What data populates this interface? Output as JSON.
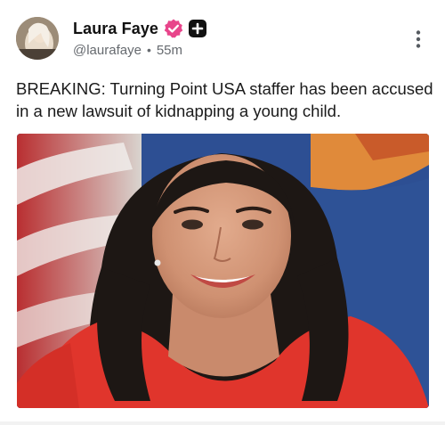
{
  "post": {
    "author": {
      "display_name": "Laura Faye",
      "handle": "@laurafaye",
      "time_ago": "55m",
      "separator": "•",
      "verified_badge_icon": "verified-badge-icon",
      "subscribe_icon": "plus-square-icon"
    },
    "menu_icon": "more-vertical-icon",
    "text": "BREAKING: Turning Point USA staffer has been accused in a new lawsuit of kidnapping a young child.",
    "media": {
      "icon": "photo",
      "colors": {
        "flag_red": "#c8322f",
        "flag_blue": "#2d4f93",
        "flag_orange": "#e08a3a",
        "dress_red": "#e0352c"
      }
    },
    "colors": {
      "verified_pink": "#e8458b",
      "plus_black": "#111111",
      "meta_gray": "#666a6f"
    }
  }
}
